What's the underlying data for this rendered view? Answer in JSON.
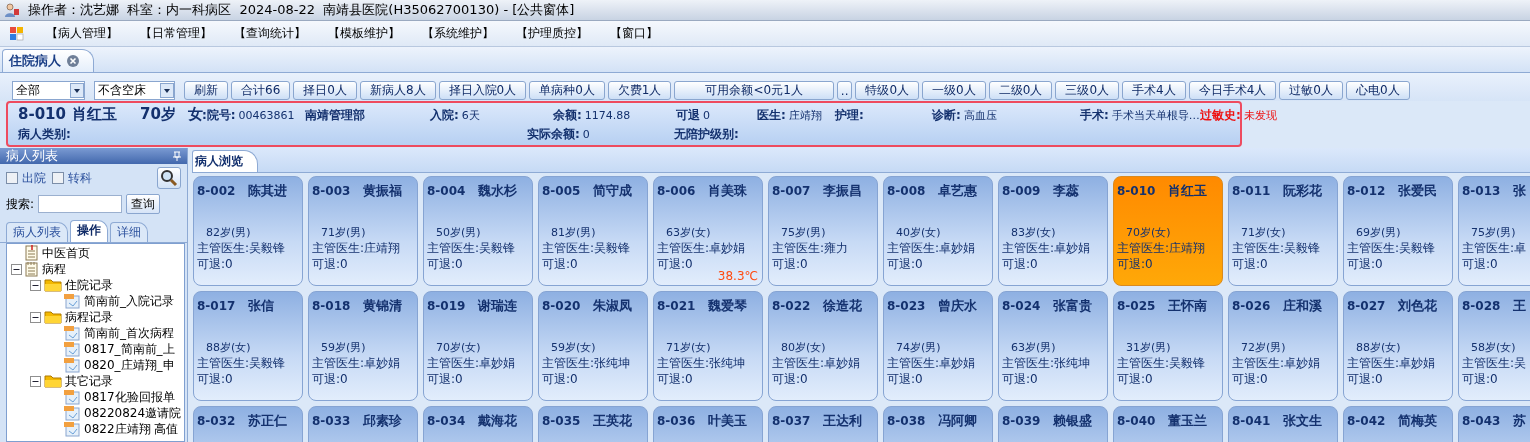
{
  "window": {
    "title": "操作者：沈艺娜  科室：内一科病区  2024-08-22  南靖县医院(H35062700130) - [公共窗体]"
  },
  "menu": [
    "【病人管理】",
    "【日常管理】",
    "【查询统计】",
    "【模板维护】",
    "【系统维护】",
    "【护理质控】",
    "【窗口】"
  ],
  "doc_tab": {
    "label": "住院病人"
  },
  "toolbar": {
    "combos": [
      {
        "value": "全部"
      },
      {
        "value": "不含空床"
      }
    ],
    "buttons": [
      {
        "label": "刷新",
        "kind": "normal"
      },
      {
        "label": "合计66",
        "kind": "normal"
      },
      {
        "label": "择日0人",
        "kind": "normal"
      },
      {
        "label": "新病人8人",
        "kind": "normal"
      },
      {
        "label": "择日入院0人",
        "kind": "normal"
      },
      {
        "label": "单病种0人",
        "kind": "normal"
      },
      {
        "label": "欠费1人",
        "kind": "normal"
      },
      {
        "label": "可用余额<0元1人",
        "kind": "wide"
      },
      {
        "label": "..",
        "kind": "small"
      },
      {
        "label": "特级0人",
        "kind": "normal"
      },
      {
        "label": "一级0人",
        "kind": "normal"
      },
      {
        "label": "二级0人",
        "kind": "normal"
      },
      {
        "label": "三级0人",
        "kind": "normal"
      },
      {
        "label": "手术4人",
        "kind": "normal"
      },
      {
        "label": "今日手术4人",
        "kind": "normal"
      },
      {
        "label": "过敏0人",
        "kind": "normal"
      },
      {
        "label": "心电0人",
        "kind": "normal"
      }
    ]
  },
  "info": {
    "rows": [
      {
        "fields": [
          {
            "label": "8-010",
            "kind": "title",
            "alert": false
          },
          {
            "label": "肖红玉",
            "kind": "title",
            "alert": false
          },
          {
            "label": "70岁",
            "kind": "title",
            "alert": false
          },
          {
            "label": "女",
            "kind": "title",
            "alert": false
          },
          {
            "label": ":院号:",
            "value": "00463861",
            "kind": "field",
            "alert": false
          },
          {
            "label": "南靖管理部",
            "kind": "field",
            "alert": false
          },
          {
            "label": "入院:",
            "value": "6天",
            "kind": "field",
            "alert": false
          },
          {
            "label": "余额:",
            "value": "1174.88",
            "kind": "field",
            "alert": false
          },
          {
            "label": "可退",
            "value": "0",
            "kind": "field",
            "alert": false
          },
          {
            "label": "医生:",
            "value": "庄靖翔",
            "kind": "field",
            "alert": false
          },
          {
            "label": "护理:",
            "kind": "field",
            "alert": false
          },
          {
            "label": "诊断:",
            "value": "高血压",
            "kind": "field",
            "alert": false
          },
          {
            "label": "手术:",
            "value": "手术当天单根导…",
            "kind": "field",
            "alert": false
          },
          {
            "label": "过敏史:",
            "value": "未发现",
            "kind": "field",
            "alert": true
          }
        ]
      },
      {
        "fields": [
          {
            "label": "病人类别:",
            "kind": "field",
            "alert": false
          },
          {
            "label": "实际余额:",
            "value": "0",
            "kind": "field",
            "alert": false
          },
          {
            "label": "无陪护级别:",
            "kind": "field",
            "alert": false
          }
        ]
      }
    ]
  },
  "sidebar": {
    "title": "病人列表",
    "checkboxes": [
      {
        "label": "出院",
        "checked": false
      },
      {
        "label": "转科",
        "checked": false
      }
    ],
    "search": {
      "label": "搜索:",
      "button": "查询"
    },
    "tabs": [
      {
        "label": "病人列表",
        "selected": false
      },
      {
        "label": "操作",
        "selected": true
      },
      {
        "label": "详细",
        "selected": false
      }
    ],
    "tree": [
      {
        "label": "中医首页",
        "kind": "doc"
      },
      {
        "label": "病程",
        "kind": "notebook",
        "expanded": true,
        "children": [
          {
            "label": "住院记录",
            "kind": "folder",
            "expanded": true,
            "children": [
              {
                "label": "简南前_入院记录",
                "kind": "file"
              }
            ]
          },
          {
            "label": "病程记录",
            "kind": "folder",
            "expanded": true,
            "children": [
              {
                "label": "简南前_首次病程",
                "kind": "file"
              },
              {
                "label": "0817_简南前_上",
                "kind": "file"
              },
              {
                "label": "0820_庄靖翔_申",
                "kind": "file"
              }
            ]
          },
          {
            "label": "其它记录",
            "kind": "folder",
            "expanded": true,
            "children": [
              {
                "label": "0817化验回报单",
                "kind": "file"
              },
              {
                "label": "08220824邀请院",
                "kind": "file"
              },
              {
                "label": "0822庄靖翔 高值",
                "kind": "file"
              }
            ]
          }
        ]
      }
    ]
  },
  "browser": {
    "tab": "病人浏览",
    "cards": [
      {
        "bed": "8-002",
        "name": "陈其进",
        "age": "82岁(男)",
        "doctor": "主管医生:吴毅锋",
        "refund": "可退:0",
        "selected": false
      },
      {
        "bed": "8-003",
        "name": "黄振福",
        "age": "71岁(男)",
        "doctor": "主管医生:庄靖翔",
        "refund": "可退:0",
        "selected": false
      },
      {
        "bed": "8-004",
        "name": "魏水杉",
        "age": "50岁(男)",
        "doctor": "主管医生:吴毅锋",
        "refund": "可退:0",
        "selected": false
      },
      {
        "bed": "8-005",
        "name": "简守成",
        "age": "81岁(男)",
        "doctor": "主管医生:吴毅锋",
        "refund": "可退:0",
        "selected": false
      },
      {
        "bed": "8-006",
        "name": "肖美珠",
        "age": "63岁(女)",
        "doctor": "主管医生:卓妙娟",
        "refund": "可退:0",
        "temperature": "38.3℃",
        "selected": false
      },
      {
        "bed": "8-007",
        "name": "李振昌",
        "age": "75岁(男)",
        "doctor": "主管医生:雍力",
        "refund": "可退:0",
        "selected": false
      },
      {
        "bed": "8-008",
        "name": "卓艺惠",
        "age": "40岁(女)",
        "doctor": "主管医生:卓妙娟",
        "refund": "可退:0",
        "selected": false
      },
      {
        "bed": "8-009",
        "name": "李蕊",
        "age": "83岁(女)",
        "doctor": "主管医生:卓妙娟",
        "refund": "可退:0",
        "selected": false
      },
      {
        "bed": "8-010",
        "name": "肖红玉",
        "age": "70岁(女)",
        "doctor": "主管医生:庄靖翔",
        "refund": "可退:0",
        "selected": true
      },
      {
        "bed": "8-011",
        "name": "阮彩花",
        "age": "71岁(女)",
        "doctor": "主管医生:吴毅锋",
        "refund": "可退:0",
        "selected": false
      },
      {
        "bed": "8-012",
        "name": "张爱民",
        "age": "69岁(男)",
        "doctor": "主管医生:吴毅锋",
        "refund": "可退:0",
        "selected": false
      },
      {
        "bed": "8-013",
        "name": "张",
        "age": "75岁(男)",
        "doctor": "主管医生:卓",
        "refund": "可退:0",
        "selected": false
      },
      {
        "bed": "8-017",
        "name": "张信",
        "age": "88岁(女)",
        "doctor": "主管医生:吴毅锋",
        "refund": "可退:0",
        "selected": false
      },
      {
        "bed": "8-018",
        "name": "黄锦清",
        "age": "59岁(男)",
        "doctor": "主管医生:卓妙娟",
        "refund": "可退:0",
        "selected": false
      },
      {
        "bed": "8-019",
        "name": "谢瑞连",
        "age": "70岁(女)",
        "doctor": "主管医生:卓妙娟",
        "refund": "可退:0",
        "selected": false
      },
      {
        "bed": "8-020",
        "name": "朱淑凤",
        "age": "59岁(女)",
        "doctor": "主管医生:张纯坤",
        "refund": "可退:0",
        "selected": false
      },
      {
        "bed": "8-021",
        "name": "魏爱琴",
        "age": "71岁(女)",
        "doctor": "主管医生:张纯坤",
        "refund": "可退:0",
        "selected": false
      },
      {
        "bed": "8-022",
        "name": "徐造花",
        "age": "80岁(女)",
        "doctor": "主管医生:卓妙娟",
        "refund": "可退:0",
        "selected": false
      },
      {
        "bed": "8-023",
        "name": "曾庆水",
        "age": "74岁(男)",
        "doctor": "主管医生:卓妙娟",
        "refund": "可退:0",
        "selected": false
      },
      {
        "bed": "8-024",
        "name": "张富贵",
        "age": "63岁(男)",
        "doctor": "主管医生:张纯坤",
        "refund": "可退:0",
        "selected": false
      },
      {
        "bed": "8-025",
        "name": "王怀南",
        "age": "31岁(男)",
        "doctor": "主管医生:吴毅锋",
        "refund": "可退:0",
        "selected": false
      },
      {
        "bed": "8-026",
        "name": "庄和溪",
        "age": "72岁(男)",
        "doctor": "主管医生:卓妙娟",
        "refund": "可退:0",
        "selected": false
      },
      {
        "bed": "8-027",
        "name": "刘色花",
        "age": "88岁(女)",
        "doctor": "主管医生:卓妙娟",
        "refund": "可退:0",
        "selected": false
      },
      {
        "bed": "8-028",
        "name": "王",
        "age": "58岁(女)",
        "doctor": "主管医生:吴",
        "refund": "可退:0",
        "selected": false
      },
      {
        "bed": "8-032",
        "name": "苏正仁",
        "selected": false
      },
      {
        "bed": "8-033",
        "name": "邱素珍",
        "selected": false
      },
      {
        "bed": "8-034",
        "name": "戴海花",
        "selected": false
      },
      {
        "bed": "8-035",
        "name": "王英花",
        "selected": false
      },
      {
        "bed": "8-036",
        "name": "叶美玉",
        "selected": false
      },
      {
        "bed": "8-037",
        "name": "王达利",
        "selected": false
      },
      {
        "bed": "8-038",
        "name": "冯阿卿",
        "selected": false
      },
      {
        "bed": "8-039",
        "name": "赖银盛",
        "selected": false
      },
      {
        "bed": "8-040",
        "name": "董玉兰",
        "selected": false
      },
      {
        "bed": "8-041",
        "name": "张文生",
        "selected": false
      },
      {
        "bed": "8-042",
        "name": "简梅英",
        "selected": false
      },
      {
        "bed": "8-043",
        "name": "苏",
        "selected": false
      }
    ]
  }
}
